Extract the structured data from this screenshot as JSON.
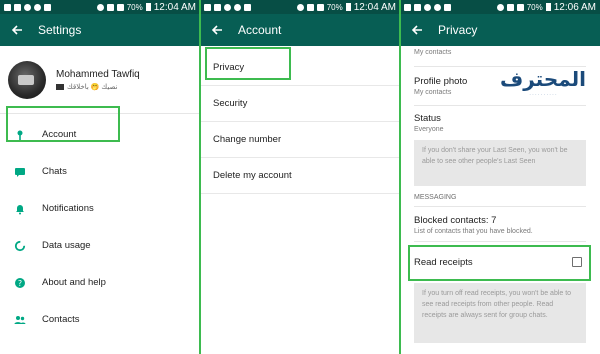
{
  "status_bar": {
    "battery": "70%",
    "time": "12:04 AM",
    "time_panel3": "12:06 AM"
  },
  "panel1": {
    "title": "Settings",
    "profile": {
      "name": "Mohammed Tawfiq",
      "status": "نصيك 🤭 باخلاقك"
    },
    "items": [
      {
        "label": "Account",
        "icon": "key-icon"
      },
      {
        "label": "Chats",
        "icon": "chat-icon"
      },
      {
        "label": "Notifications",
        "icon": "bell-icon"
      },
      {
        "label": "Data usage",
        "icon": "data-usage-icon"
      },
      {
        "label": "About and help",
        "icon": "help-icon"
      },
      {
        "label": "Contacts",
        "icon": "contacts-icon"
      }
    ]
  },
  "panel2": {
    "title": "Account",
    "items": [
      {
        "label": "Privacy"
      },
      {
        "label": "Security"
      },
      {
        "label": "Change number"
      },
      {
        "label": "Delete my account"
      }
    ]
  },
  "panel3": {
    "title": "Privacy",
    "top_sub": "My contacts",
    "profile_photo": {
      "title": "Profile photo",
      "value": "My contacts"
    },
    "status": {
      "title": "Status",
      "value": "Everyone"
    },
    "last_seen_info": "If you don't share your Last Seen, you won't be able to see other people's Last Seen",
    "messaging_header": "MESSAGING",
    "blocked": {
      "title": "Blocked contacts: 7",
      "sub": "List of contacts that you have blocked."
    },
    "read_receipts": {
      "title": "Read receipts",
      "checked": false
    },
    "read_receipts_info": "If you turn off read receipts, you won't be able to see read receipts from other people. Read receipts are always sent for group chats.",
    "watermark": "المحترف"
  },
  "colors": {
    "status_bar": "#074e45",
    "app_bar": "#075e54",
    "accent": "#00a884",
    "highlight": "#3dbb4f"
  }
}
